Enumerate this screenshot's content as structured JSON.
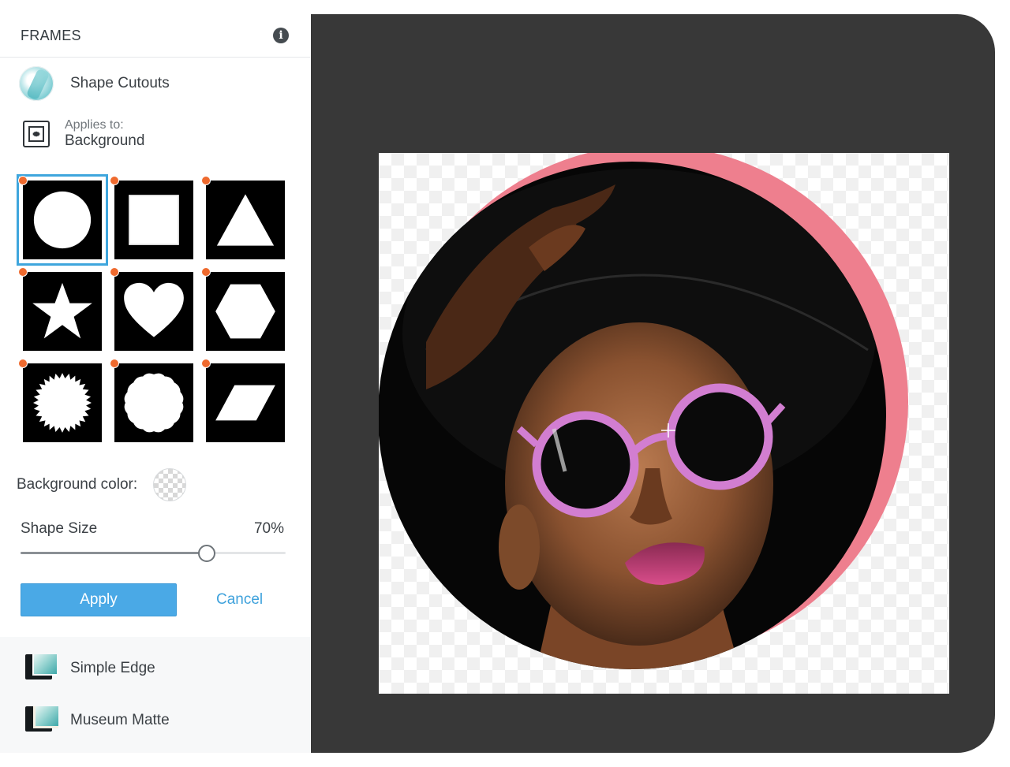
{
  "panel": {
    "title": "FRAMES",
    "info_glyph": "i",
    "category": {
      "label": "Shape Cutouts",
      "icon": "shape-cutouts-thumbnail"
    },
    "applies": {
      "label": "Applies to:",
      "value": "Background",
      "icon": "gear-frame-icon"
    },
    "shapes": [
      {
        "name": "circle",
        "selected": true
      },
      {
        "name": "square",
        "selected": false
      },
      {
        "name": "triangle",
        "selected": false
      },
      {
        "name": "star",
        "selected": false
      },
      {
        "name": "heart",
        "selected": false
      },
      {
        "name": "hexagon",
        "selected": false
      },
      {
        "name": "starburst",
        "selected": false
      },
      {
        "name": "scalloped",
        "selected": false
      },
      {
        "name": "parallelogram",
        "selected": false
      }
    ],
    "background_color": {
      "label": "Background color:",
      "value": "transparent"
    },
    "shape_size": {
      "label": "Shape Size",
      "value_text": "70%",
      "value": 0.7
    },
    "apply_label": "Apply",
    "cancel_label": "Cancel",
    "other_frames": [
      {
        "label": "Simple Edge",
        "icon": "simple-edge-icon"
      },
      {
        "label": "Museum Matte",
        "icon": "museum-matte-icon"
      }
    ]
  },
  "colors": {
    "accent": "#4aa9e6",
    "selection": "#3fa6dd",
    "marker_dot": "#ef6a2e",
    "canvas_bg": "#383838",
    "pink_ring": "#ee7f8e"
  }
}
